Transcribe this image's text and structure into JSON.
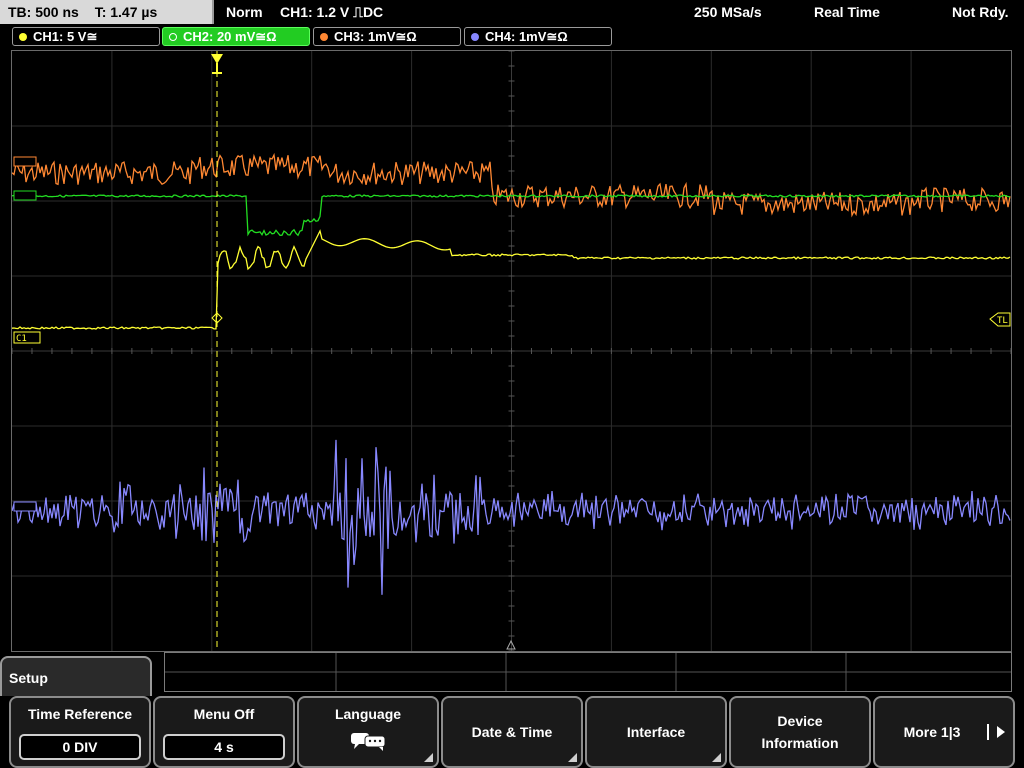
{
  "status": {
    "timebase": "TB: 500 ns",
    "trigger_time": "T: 1.47 µs",
    "mode": "Norm",
    "trigger": "CH1: 1.2 V ⎍DC",
    "sample_rate": "250 MSa/s",
    "acquisition": "Real Time",
    "ready": "Not Rdy."
  },
  "channels": [
    {
      "label": "CH1: 5 V≅",
      "color": "#ffff33",
      "active": false
    },
    {
      "label": "CH2: 20 mV≅Ω",
      "color": "#22dd22",
      "active": true
    },
    {
      "label": "CH3: 1mV≅Ω",
      "color": "#ff8833",
      "active": false
    },
    {
      "label": "CH4: 1mV≅Ω",
      "color": "#8888ff",
      "active": false
    }
  ],
  "markers": {
    "ch1": "C1",
    "trigger_level": "TL"
  },
  "menu": {
    "title": "Setup",
    "softkeys": [
      {
        "title": "Time Reference",
        "value": "0 DIV"
      },
      {
        "title": "Menu Off",
        "value": "4 s"
      },
      {
        "title": "Language",
        "icon": "speech-bubbles-icon"
      },
      {
        "title": "Date & Time"
      },
      {
        "title": "Interface"
      },
      {
        "title_line1": "Device",
        "title_line2": "Information"
      },
      {
        "title": "More 1|3"
      }
    ]
  }
}
